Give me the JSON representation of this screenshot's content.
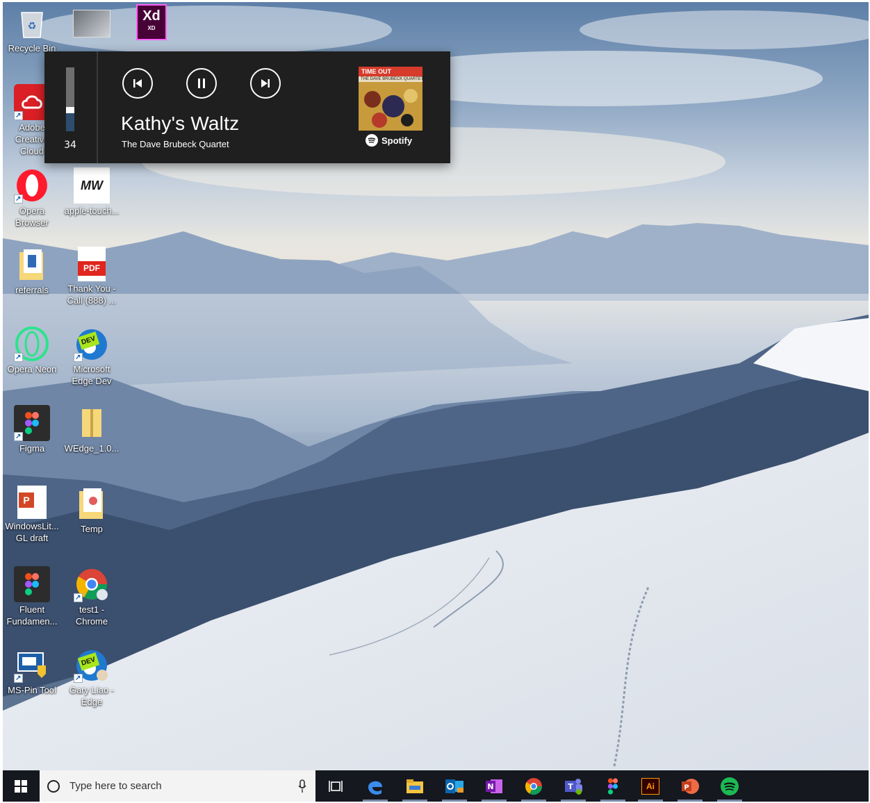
{
  "desktop": {
    "icons": [
      {
        "label": "Recycle Bin",
        "icon": "recycle-bin-icon"
      },
      {
        "label": "",
        "icon": "screenshot-file-icon"
      },
      {
        "label": "",
        "icon": "adobe-xd-icon",
        "badge": "Xd",
        "sub": "XD"
      },
      {
        "label": "Adobe Creative Cloud",
        "icon": "adobe-creative-cloud-icon"
      },
      {
        "label": "Opera Browser",
        "icon": "opera-icon"
      },
      {
        "label": "apple-touch...",
        "icon": "mw-image-icon",
        "badge": "MW"
      },
      {
        "label": "referrals",
        "icon": "folder-icon"
      },
      {
        "label": "Thank You - Call (888) ...",
        "icon": "pdf-icon",
        "badge": "PDF"
      },
      {
        "label": "Opera Neon",
        "icon": "opera-neon-icon"
      },
      {
        "label": "Microsoft Edge Dev",
        "icon": "edge-dev-icon",
        "badge": "DEV"
      },
      {
        "label": "Figma",
        "icon": "figma-icon"
      },
      {
        "label": "WEdge_1.0...",
        "icon": "zip-folder-icon"
      },
      {
        "label": "WindowsLit... GL draft",
        "icon": "powerpoint-file-icon",
        "badge": "P"
      },
      {
        "label": "Temp",
        "icon": "folder-icon"
      },
      {
        "label": "Fluent Fundamen...",
        "icon": "figma-file-icon"
      },
      {
        "label": "test1 - Chrome",
        "icon": "chrome-profile-icon"
      },
      {
        "label": "MS-Pin Tool",
        "icon": "pin-tool-icon"
      },
      {
        "label": "Gary Liao - Edge",
        "icon": "edge-dev-profile-icon",
        "badge": "DEV"
      }
    ]
  },
  "media": {
    "volume": 34,
    "volume_label": "34",
    "track_title": "Kathy's Waltz",
    "artist": "The Dave Brubeck Quartet",
    "source": "Spotify",
    "album_text_top": "TIME OUT",
    "album_text_sub": "THE DAVE BRUBECK QUARTET",
    "controls": [
      "previous-track",
      "pause",
      "next-track"
    ]
  },
  "taskbar": {
    "search_placeholder": "Type here to search",
    "apps": [
      {
        "name": "task-view-icon"
      },
      {
        "name": "edge-icon"
      },
      {
        "name": "file-explorer-icon"
      },
      {
        "name": "outlook-icon"
      },
      {
        "name": "onenote-icon"
      },
      {
        "name": "chrome-icon"
      },
      {
        "name": "teams-icon"
      },
      {
        "name": "figma-icon"
      },
      {
        "name": "illustrator-icon",
        "badge": "Ai"
      },
      {
        "name": "powerpoint-icon",
        "badge": "P"
      },
      {
        "name": "spotify-icon"
      }
    ]
  },
  "colors": {
    "taskbar": "#15181f",
    "flyout": "#1f1f1f",
    "spotify": "#1db954",
    "volume_fill": "#2c4d6e"
  }
}
